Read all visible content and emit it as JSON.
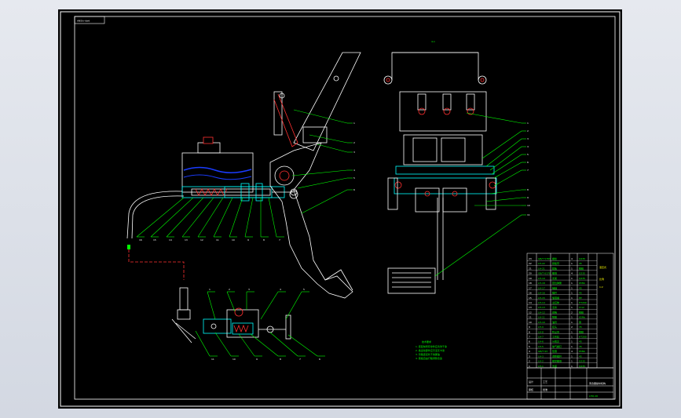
{
  "drawing": {
    "title_tag": "ANSIn-dwd",
    "dimension_label": "4-1"
  },
  "colors": {
    "background": "#000000",
    "frame": "#ffffff",
    "callout": "#00ff00",
    "cut_line": "#ff0000",
    "section": "#00ffff",
    "fluid": "#1a3cff",
    "hatch": "#ff3030",
    "label": "#ffff00"
  },
  "callouts": {
    "top_right_view": [
      "1",
      "2",
      "3",
      "4",
      "5",
      "6",
      "7",
      "8",
      "9",
      "10",
      "11",
      "12"
    ],
    "bottom_row": [
      "16",
      "15",
      "14",
      "13",
      "12",
      "11",
      "10",
      "9",
      "8",
      "7"
    ],
    "pedal_side": [
      "1",
      "2",
      "3",
      "4",
      "5",
      "6"
    ],
    "lower_assembly_top": [
      "1",
      "2",
      "3",
      "4",
      "5"
    ],
    "lower_assembly_bottom": [
      "11",
      "10",
      "9",
      "8",
      "7",
      "6"
    ]
  },
  "notes": {
    "heading": "技术要求",
    "lines": [
      "1. 装配前所有零件应清洗干净",
      "2. 各运动部件应灵活无卡滞",
      "3. 管路连接处不得漏油",
      "4. 踏板自由行程调整合适"
    ]
  },
  "parts_table": {
    "rows": [
      [
        "23",
        "GB/T 5783",
        "螺栓",
        "4",
        "Q235"
      ],
      [
        "22",
        "LH-22",
        "踏板臂",
        "1",
        "45"
      ],
      [
        "21",
        "LH-21",
        "踏板",
        "1",
        "橡胶"
      ],
      [
        "20",
        "GB/T 6170",
        "螺母",
        "4",
        "Q235"
      ],
      [
        "19",
        "LH-19",
        "支架",
        "1",
        "Q235"
      ],
      [
        "18",
        "LH-18",
        "回位弹簧",
        "1",
        "65Mn"
      ],
      [
        "17",
        "LH-17",
        "销轴",
        "1",
        "45"
      ],
      [
        "16",
        "LH-16",
        "推杆",
        "1",
        "45"
      ],
      [
        "15",
        "LH-15",
        "储液罐",
        "1",
        "PP"
      ],
      [
        "14",
        "LH-14",
        "主缸体",
        "1",
        "HT200"
      ],
      [
        "13",
        "LH-13",
        "活塞",
        "1",
        "LY12"
      ],
      [
        "12",
        "LH-12",
        "皮碗",
        "2",
        "橡胶"
      ],
      [
        "11",
        "LH-11",
        "弹簧",
        "1",
        "65Mn"
      ],
      [
        "10",
        "LH-10",
        "油管",
        "1",
        "铜"
      ],
      [
        "9",
        "LH-9",
        "接头",
        "2",
        "35"
      ],
      [
        "8",
        "LH-8",
        "防尘罩",
        "1",
        "橡胶"
      ],
      [
        "7",
        "LH-7",
        "工作缸",
        "1",
        "HT200"
      ],
      [
        "6",
        "LH-6",
        "分离叉",
        "1",
        "45"
      ],
      [
        "5",
        "LH-5",
        "放气螺钉",
        "1",
        "35"
      ],
      [
        "4",
        "GB/T 93",
        "垫圈",
        "4",
        "65Mn"
      ],
      [
        "3",
        "LH-3",
        "调整螺杆",
        "1",
        "45"
      ],
      [
        "2",
        "LH-2",
        "锁紧螺母",
        "1",
        "Q235"
      ],
      [
        "1",
        "LH-1",
        "支座",
        "1",
        "Q235"
      ]
    ],
    "header": [
      "序号",
      "代号",
      "名称",
      "数量",
      "材料"
    ],
    "side_labels": [
      "液压式",
      "比例",
      "1:2"
    ]
  },
  "title_block": {
    "name": "离合器操纵机构",
    "drawing_no": "LHQ-00",
    "cells": [
      "设计",
      "审核",
      "工艺",
      "批准"
    ]
  }
}
